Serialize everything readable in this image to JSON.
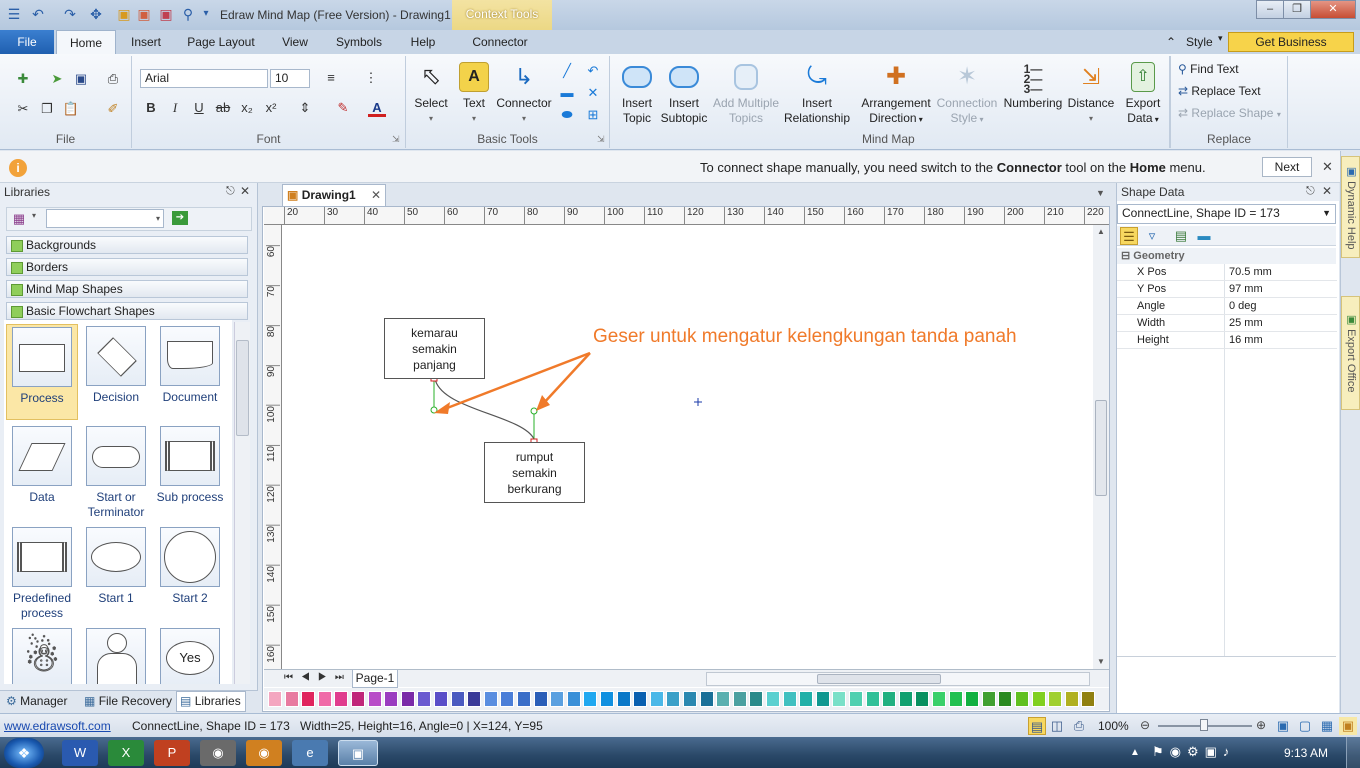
{
  "window": {
    "title": "Edraw Mind Map (Free Version) - Drawing1",
    "context_tools": "Context Tools"
  },
  "quick_access": [
    "save-icon",
    "undo-icon",
    "redo-icon",
    "new-icon",
    "open-icon",
    "print-icon",
    "preview-icon"
  ],
  "tabs": {
    "file": "File",
    "home": "Home",
    "insert": "Insert",
    "page_layout": "Page Layout",
    "view": "View",
    "symbols": "Symbols",
    "help": "Help",
    "connector": "Connector"
  },
  "header_right": {
    "style": "Style",
    "business": "Get Business Version..."
  },
  "ribbon": {
    "groups": {
      "file": "File",
      "font": "Font",
      "basic_tools": "Basic Tools",
      "mind_map": "Mind Map",
      "replace": "Replace"
    },
    "font": {
      "family": "Arial",
      "size": "10"
    },
    "tools": {
      "select": "Select",
      "text": "Text",
      "connector": "Connector"
    },
    "mindmap": {
      "insert_topic": [
        "Insert",
        "Topic"
      ],
      "insert_subtopic": [
        "Insert",
        "Subtopic"
      ],
      "add_multiple": [
        "Add Multiple",
        "Topics"
      ],
      "insert_relationship": [
        "Insert",
        "Relationship"
      ],
      "arrangement": [
        "Arrangement",
        "Direction"
      ],
      "connection_style": [
        "Connection",
        "Style"
      ],
      "numbering": "Numbering",
      "distance": "Distance",
      "export_data": [
        "Export",
        "Data"
      ]
    },
    "replace": {
      "find": "Find Text",
      "replace_text": "Replace Text",
      "replace_shape": "Replace Shape"
    }
  },
  "infobar": {
    "prefix": "To connect shape manually, you need switch to the ",
    "tool": "Connector",
    "middle": " tool on the ",
    "menu": "Home",
    "suffix": " menu.",
    "next": "Next"
  },
  "libraries": {
    "title": "Libraries",
    "categories": [
      "Backgrounds",
      "Borders",
      "Mind Map Shapes",
      "Basic Flowchart Shapes"
    ],
    "shapes": [
      {
        "label": "Process"
      },
      {
        "label": "Decision"
      },
      {
        "label": "Document"
      },
      {
        "label": "Data"
      },
      {
        "label": "Start or Terminator"
      },
      {
        "label": "Sub process"
      },
      {
        "label": "Predefined process"
      },
      {
        "label": "Start 1"
      },
      {
        "label": "Start 2"
      },
      {
        "label": ""
      },
      {
        "label": ""
      },
      {
        "label": "Yes"
      }
    ],
    "bottom_tabs": {
      "manager": "Manager",
      "file_recovery": "File Recovery",
      "libraries": "Libraries"
    }
  },
  "document": {
    "tab": "Drawing1",
    "page_tab": "Page-1",
    "h_ruler": [
      "20",
      "30",
      "40",
      "50",
      "60",
      "70",
      "80",
      "90",
      "100",
      "110",
      "120",
      "130",
      "140",
      "150",
      "160",
      "170",
      "180",
      "190",
      "200",
      "210",
      "220"
    ],
    "v_ruler": [
      "60",
      "70",
      "80",
      "90",
      "100",
      "110",
      "120",
      "130",
      "140",
      "150",
      "160"
    ],
    "shape1": [
      "kemarau",
      "semakin",
      "panjang"
    ],
    "shape2": [
      "rumput",
      "semakin",
      "berkurang"
    ],
    "annotation": "Geser untuk mengatur kelengkungan tanda panah",
    "annotation_color": "#f07a2a"
  },
  "palette": [
    "#f4a6c0",
    "#e87aa0",
    "#e0245e",
    "#f06aa8",
    "#e03c8e",
    "#c0267a",
    "#b84cc8",
    "#9a3cc0",
    "#7a2aa8",
    "#6a5ad0",
    "#5a4ec8",
    "#4a5ac0",
    "#3a3a98",
    "#5a8ee0",
    "#4a7ed8",
    "#3a6ec8",
    "#2a5eb8",
    "#5aa0e0",
    "#3a90d8",
    "#20a8f0",
    "#1090e0",
    "#0a78c8",
    "#0a60b0",
    "#4ab8e8",
    "#3aa0c8",
    "#2a88b0",
    "#1a7098",
    "#5ab0b0",
    "#4aa0a0",
    "#2a8a8a",
    "#5ad0d0",
    "#40c0c0",
    "#20b0a8",
    "#109890",
    "#7ae0c8",
    "#50d0b0",
    "#30c098",
    "#20b080",
    "#10a070",
    "#089060",
    "#3ad06a",
    "#20c050",
    "#10b040",
    "#40a030",
    "#2a8a20",
    "#60c020",
    "#80d020",
    "#a0d030",
    "#b0b020",
    "#908010"
  ],
  "shape_data": {
    "title": "Shape Data",
    "selector": "ConnectLine, Shape ID = 173",
    "section": "Geometry",
    "rows": [
      {
        "key": "X Pos",
        "value": "70.5 mm"
      },
      {
        "key": "Y Pos",
        "value": "97 mm"
      },
      {
        "key": "Angle",
        "value": "0 deg"
      },
      {
        "key": "Width",
        "value": "25 mm"
      },
      {
        "key": "Height",
        "value": "16 mm"
      }
    ]
  },
  "right_dock": {
    "dynamic_help": "Dynamic Help",
    "export_office": "Export Office"
  },
  "status": {
    "link": "www.edrawsoft.com",
    "shape": "ConnectLine, Shape ID = 173",
    "info": "Width=25, Height=16, Angle=0 | X=124, Y=95",
    "zoom": "100%"
  },
  "taskbar": {
    "time": "9:13 AM"
  }
}
